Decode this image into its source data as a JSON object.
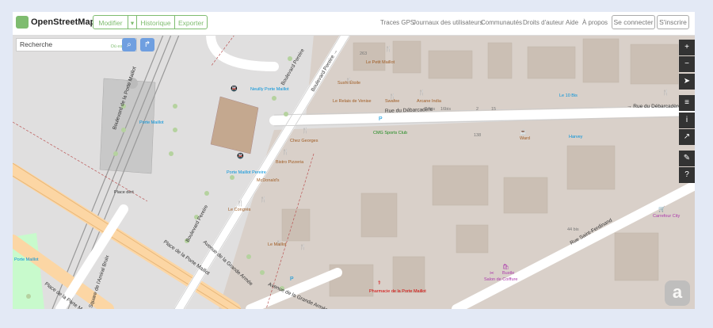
{
  "header": {
    "brand": "OpenStreetMap",
    "buttons": {
      "edit": "Modifier",
      "edit_dropdown": "▾",
      "history": "Historique",
      "export": "Exporter"
    },
    "nav_links": [
      "Traces GPS",
      "Journaux des utilisateurs",
      "Communautés",
      "Droits d'auteur",
      "Aide",
      "À propos"
    ],
    "login": "Se connecter",
    "signup": "S'inscrire"
  },
  "search": {
    "placeholder": "Recherche",
    "where_link": "Où est-ce ?",
    "go_icon": "search-icon",
    "directions_icon": "directions-icon"
  },
  "map_controls": [
    "zoom-in-icon",
    "zoom-out-icon",
    "locate-icon",
    "layers-icon",
    "info-icon",
    "share-icon",
    "note-icon",
    "query-icon"
  ],
  "colors": {
    "accent": "#7ebc6f",
    "primary_road": "#fcd6a4",
    "building": "#d9d0c9",
    "landuse": "#e0dfdf",
    "blue_search": "#6f9fe0"
  },
  "map_labels": {
    "rue_debarcadere_a": "Rue du Débarcadère",
    "rue_debarcadere_b": "→ Rue du Débarcadère",
    "boulevard_pereire_a": "Boulevard Pereire",
    "boulevard_pereire_b": "Boulevard Pereire",
    "boulevard_pereire_c": "Boulevard Pereire →",
    "place_porte_maillot": "Place de la Porte Maillot",
    "place_porte_maillot_b": "Place de la Porte Maillot",
    "rue_saint_ferdinand": "Rue Saint-Ferdinand",
    "avenue_grande_armee": "Avenue de la Grande Armée",
    "avenue_grande_armee_b": "Avenue de la Grande Armée",
    "boulevard_porte_maillot": "Boulevard de la Porte Maillot",
    "square_amiral_bruix": "Square de l'Amiral Bruix",
    "neuilly_porte_maillot": "Neuilly Porte Maillot",
    "porte_maillot_pereire": "Porte Maillot Pereire",
    "porte_maillot": "Porte Maillot",
    "cmg_sports": "CMG Sports Club",
    "chez_georges": "Chez Georges",
    "bistro": "Bistro Pizzeria",
    "le_petit_maillot": "Le Petit Maillot",
    "sushi_etoile": "Sushi Étoile",
    "le_relais": "Le Relais de Venise",
    "swafee": "Swafee",
    "arcane": "Arcane India",
    "le_10bis": "Le 10 Bis",
    "ward": "Ward",
    "harvey": "Harvey",
    "mcdonalds": "McDonald's",
    "le_congres": "Le Congrès",
    "le_maillot": "Le Maillot",
    "pharmacie": "Pharmacie de la Porte Maillot",
    "carrefour": "Carrefour City",
    "salon": "Salon de Coiffure",
    "bustle": "Bustle",
    "place_dert": "Place dert",
    "porte_maillot_rer": "Porte Maillot",
    "house_263": "263",
    "house_14bis": "14bis",
    "house_16bis": "16bis",
    "house_2": "2",
    "house_15": "15",
    "house_138": "138",
    "house_44": "44 bis"
  }
}
